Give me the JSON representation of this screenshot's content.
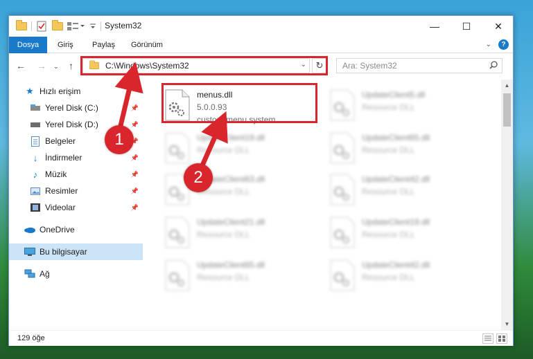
{
  "window": {
    "title": "System32",
    "controls": {
      "minimize": "—",
      "maximize": "☐",
      "close": "✕"
    }
  },
  "ribbon": {
    "tabs": [
      "Dosya",
      "Giriş",
      "Paylaş",
      "Görünüm"
    ]
  },
  "navigation": {
    "address": "C:\\Windows\\System32",
    "search_placeholder": "Ara: System32"
  },
  "sidebar": {
    "items": [
      {
        "label": "Hızlı erişim",
        "icon": "star-icon",
        "pinned": false
      },
      {
        "label": "Yerel Disk (C:)",
        "icon": "drive-icon",
        "pinned": true
      },
      {
        "label": "Yerel Disk (D:)",
        "icon": "drive-icon",
        "pinned": true
      },
      {
        "label": "Belgeler",
        "icon": "documents-icon",
        "pinned": true
      },
      {
        "label": "İndirmeler",
        "icon": "downloads-icon",
        "pinned": true
      },
      {
        "label": "Müzik",
        "icon": "music-icon",
        "pinned": true
      },
      {
        "label": "Resimler",
        "icon": "pictures-icon",
        "pinned": true
      },
      {
        "label": "Videolar",
        "icon": "videos-icon",
        "pinned": true
      },
      {
        "label": "OneDrive",
        "icon": "onedrive-icon",
        "pinned": false
      },
      {
        "label": "Bu bilgisayar",
        "icon": "computer-icon",
        "pinned": false,
        "selected": true
      },
      {
        "label": "Ağ",
        "icon": "network-icon",
        "pinned": false
      }
    ]
  },
  "files": [
    {
      "name": "menus.dll",
      "version": "5.0.0.93",
      "description": "custom menu system ...",
      "highlighted": true
    },
    {
      "name": "UpdateClient5.dll",
      "description": "Resource DLL"
    },
    {
      "name": "UpdateClient19.dll",
      "description": "Resource DLL"
    },
    {
      "name": "UpdateClient65.dll",
      "description": "Resource DLL"
    },
    {
      "name": "UpdateClient63.dll",
      "description": "Resource DLL"
    },
    {
      "name": "UpdateClient42.dll",
      "description": "Resource DLL"
    },
    {
      "name": "UpdateClient21.dll",
      "description": "Resource DLL"
    },
    {
      "name": "UpdateClient19.dll",
      "description": "Resource DLL"
    },
    {
      "name": "UpdateClient65.dll",
      "description": "Resource DLL"
    },
    {
      "name": "UpdateClient42.dll",
      "description": "Resource DLL"
    }
  ],
  "status": {
    "item_count": "129 öğe"
  },
  "annotations": {
    "step1": "1",
    "step2": "2",
    "color": "#d9262c"
  }
}
